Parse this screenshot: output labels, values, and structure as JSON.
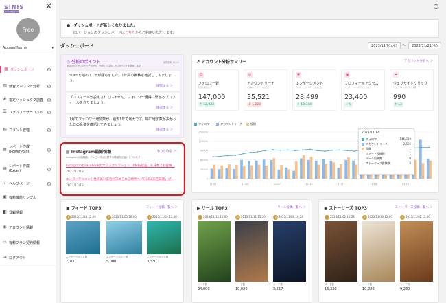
{
  "brand": {
    "logo_text": "SINIS",
    "logo_sub": "for Instagram"
  },
  "sidebar": {
    "plan": "Free",
    "account": "AccountName",
    "items": [
      {
        "label": "ダッシュボード",
        "icon": "dashboard-icon"
      },
      {
        "label": "競合アカウント分析",
        "icon": "competitor-icon"
      },
      {
        "label": "指定ハッシュタグ調査",
        "icon": "hashtag-icon"
      },
      {
        "label": "ファンユーザーリスト",
        "icon": "user-list-icon"
      },
      {
        "label": "コメント管理",
        "icon": "comment-icon"
      },
      {
        "label": "レポート作成",
        "label2": "(PowerPoint)",
        "icon": "report-icon"
      },
      {
        "label": "レポート作成",
        "label2": "(Excel)",
        "icon": "report-icon"
      },
      {
        "label": "ヘルプページ",
        "icon": "help-page-icon"
      },
      {
        "label": "有料機能サンプル",
        "icon": "sample-icon"
      },
      {
        "label": "登録情報",
        "icon": "registration-icon"
      },
      {
        "label": "アカウント情報",
        "icon": "account-icon"
      },
      {
        "label": "有料プラン契約情報",
        "icon": "plan-icon"
      },
      {
        "label": "ログアウト",
        "icon": "logout-icon"
      }
    ]
  },
  "banner": {
    "title": "ダッシュボードが新しくなりました。",
    "text_before": "旧バージョンのダッシュボードは",
    "link": "こちら",
    "text_after": "からご利用いただけます。"
  },
  "dashboard": {
    "title": "ダッシュボード",
    "date_from": "2023/11/01(水)",
    "date_sep": "〜",
    "date_to": "2023/11/21(火)"
  },
  "points": {
    "title": "分析のポイント",
    "subtitle": "あなたのアカウントデータから、分析して注目したいポイントを提案します。",
    "updated": "最終更新 11/12",
    "items": [
      {
        "text": "SINISを始めて1年が経ちました。1年間の推移を確認してみましょう。",
        "link": "確認する ＞"
      },
      {
        "text": "プロフィールが設定されていません。フォロワー獲得に繋がるプロフィールを作りましょう。",
        "link": "確認する ＞"
      },
      {
        "text": "1月のフォロワー増加数が、過去1年で最大です。特に増加数が多かった日の投稿を確認してみましょう。",
        "link": "確認する ＞"
      }
    ]
  },
  "news": {
    "title": "Instagram最新情報",
    "more": "もっとみる ＞",
    "subtitle": "Instagramの新機能、アルゴリズムに関する情報をお届けしています",
    "items": [
      {
        "link": "InstagramとFacebookのサブスクリプション「Meta認証」を日本でも提供…",
        "date": "2023/12/12"
      },
      {
        "link": "エンターテイメント性の高い広告が求められる時代へ「TikTok広告白書」が…",
        "date": "2023/12/12"
      }
    ]
  },
  "summary": {
    "title": "アカウント分析サマリー",
    "more": "アカウント分析へ ＞",
    "metrics": [
      {
        "name": "フォロワー数",
        "sub": "各日の累計数",
        "value": "147,000",
        "delta": "↑ 12,022",
        "dir": "up",
        "icon": "follower-icon"
      },
      {
        "name": "アカウントリーチ",
        "sub": "1日毎のアカウントの合計",
        "value": "35,521",
        "delta": "↓ 1,222",
        "dir": "down",
        "icon": "reach-icon"
      },
      {
        "name": "エンゲージメント",
        "sub": "いいね・コメント・保存の合計",
        "value": "28,499",
        "delta": "↑ 12,334",
        "dir": "up",
        "icon": "engagement-icon"
      },
      {
        "name": "プロフィールアクセス",
        "sub": "プロフィールへのアクセス数",
        "value": "23,400",
        "delta": "↑ 0",
        "dir": "up",
        "icon": "profile-icon"
      },
      {
        "name": "ウェブサイトクリック",
        "sub": "ウェブサイトのクリック数",
        "value": "990",
        "delta": "↑ 12",
        "dir": "up",
        "icon": "web-click-icon"
      }
    ],
    "legend": [
      "フォロワー",
      "アカウントリーチ",
      "投稿"
    ]
  },
  "chart_data": {
    "type": "bar",
    "x": [
      "11/1",
      "11/2",
      "11/3",
      "11/4",
      "11/5",
      "11/6",
      "11/7",
      "11/8",
      "11/9",
      "11/10",
      "11/11",
      "11/12",
      "11/13",
      "11/14",
      "11/15",
      "11/16",
      "11/17",
      "11/18",
      "11/19",
      "11/20",
      "11/21",
      "11/22",
      "11/23",
      "11/24",
      "11/25",
      "11/26",
      "11/27",
      "11/28",
      "11/29",
      "11/30"
    ],
    "tick_labels": [
      "11/01",
      "11/04",
      "11/07",
      "11/10",
      "11/13",
      "11/16",
      "11/19"
    ],
    "y_ticks": [
      "150000",
      "120000",
      "90000",
      "60000",
      "30000",
      "0"
    ],
    "ylim": [
      0,
      150000
    ],
    "series": [
      {
        "name": "アカウントリーチ",
        "type": "bar",
        "color": "#8ab9f0",
        "values": [
          32000,
          30000,
          34000,
          31000,
          60000,
          56000,
          58000,
          61000,
          60000,
          28000,
          36000,
          25000,
          65000,
          60000,
          57000,
          62000,
          56000,
          35000,
          60000,
          58000,
          66000,
          55000,
          68000,
          120000,
          62000,
          115000,
          60000,
          118000,
          125000,
          63000
        ]
      },
      {
        "name": "投稿",
        "type": "bar",
        "color": "#f8c08a",
        "values": [
          45000,
          42000,
          46000,
          44000,
          40000,
          43000,
          45000,
          42000,
          66000,
          44000,
          30000,
          55000,
          75000,
          70000,
          45000,
          48000,
          52000,
          47000,
          68000,
          45000,
          72000,
          40000,
          60000,
          48000,
          50000,
          115000,
          52000,
          60000,
          50000,
          58000
        ]
      },
      {
        "name": "フォロワー",
        "type": "line",
        "color": "#4aa6c6",
        "values": [
          70000,
          72000,
          74000,
          75000,
          80000,
          84000,
          86000,
          90000,
          93000,
          91000,
          92000,
          90000,
          92000,
          94000,
          90000,
          88000,
          91000,
          92000,
          90000,
          88000,
          91000,
          92000,
          90000,
          93000,
          92000,
          94000,
          96000,
          98000,
          100000,
          100000
        ]
      }
    ],
    "tooltip": {
      "date": "2023/11/14",
      "rows": [
        {
          "label": "フォロワー",
          "value": "146,380",
          "color": "#4aa6c6"
        },
        {
          "label": "アカウントリーチ",
          "value": "2,566",
          "color": "#8ab9f0"
        },
        {
          "label": "投稿",
          "value": "1",
          "color": "#f8c08a"
        },
        {
          "label": "フィード投稿数",
          "value": "1",
          "color": ""
        },
        {
          "label": "リール投稿数",
          "value": "0",
          "color": ""
        },
        {
          "label": "ストーリーズ投稿数",
          "value": "0",
          "color": ""
        }
      ]
    }
  },
  "feed": {
    "title": "フィード TOP3",
    "more": "フィード投稿一覧へ ＞",
    "posts": [
      {
        "rank": "1",
        "date": "2023/11/18 12:24",
        "label": "エンゲージメント数",
        "value": "7,700",
        "img": "sea-photo",
        "c1": "#5aa3c7",
        "c2": "#1e6e8f"
      },
      {
        "rank": "2",
        "date": "2023/11/05 16:00",
        "label": "エンゲージメント数",
        "value": "5,000",
        "img": "pier-photo",
        "c1": "#8fd0e8",
        "c2": "#2f7fa0"
      },
      {
        "rank": "3",
        "date": "2023/11/02 12:00",
        "label": "エンゲージメント数",
        "value": "3,330",
        "img": "lagoon-photo",
        "c1": "#2fb7b0",
        "c2": "#1c6f4c"
      }
    ]
  },
  "reel": {
    "title": "リール TOP3",
    "more": "リール投稿一覧へ ＞",
    "posts": [
      {
        "rank": "1",
        "date": "2023/11/15 15:00",
        "label": "リーチ数",
        "value": "24,000",
        "img": "forest-photo",
        "c1": "#6fa24a",
        "c2": "#23421c"
      },
      {
        "rank": "2",
        "date": "2023/11/11 15:30",
        "label": "リーチ数",
        "value": "10,020",
        "img": "night-path-photo",
        "c1": "#3a3f4a",
        "c2": "#b07a4a"
      },
      {
        "rank": "3",
        "date": "2023/11/08 10:24",
        "label": "リーチ数",
        "value": "3,557",
        "img": "planet-photo",
        "c1": "#27406b",
        "c2": "#0c1424"
      }
    ]
  },
  "stories": {
    "title": "ストーリーズ TOP3",
    "more": "ストーリーズ投稿一覧へ ＞",
    "posts": [
      {
        "rank": "1",
        "date": "2023/11/02 16:24",
        "label": "リーチ数",
        "value": "16,330",
        "img": "cafe-photo",
        "c1": "#7a5236",
        "c2": "#2f2218"
      },
      {
        "rank": "2",
        "date": "2023/11/30 12:00",
        "label": "リーチ数",
        "value": "10,020",
        "img": "gift-photo",
        "c1": "#ede4d6",
        "c2": "#a8875a"
      },
      {
        "rank": "3",
        "date": "2023/11/02 12:00",
        "label": "リーチ数",
        "value": "9,230",
        "img": "corridor-photo",
        "c1": "#c28e57",
        "c2": "#6b3b1c"
      }
    ]
  }
}
